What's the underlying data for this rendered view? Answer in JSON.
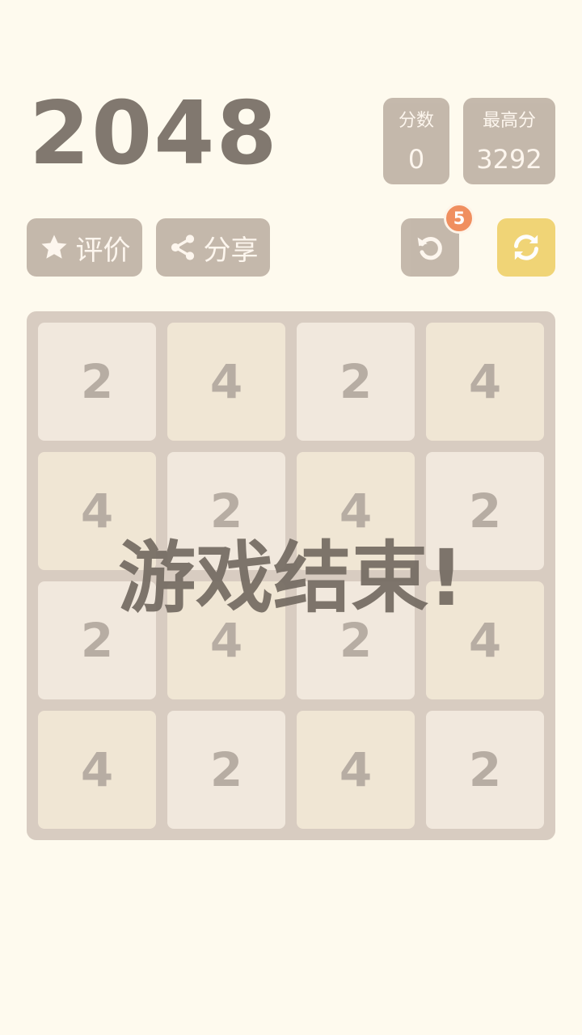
{
  "title": "2048",
  "score": {
    "label": "分数",
    "value": "0"
  },
  "best": {
    "label": "最高分",
    "value": "3292"
  },
  "buttons": {
    "rate": {
      "label": "评价",
      "icon": "star-icon"
    },
    "share": {
      "label": "分享",
      "icon": "share-icon"
    },
    "undo": {
      "icon": "undo-icon",
      "badge": "5"
    },
    "restart": {
      "icon": "refresh-icon"
    }
  },
  "board": {
    "rows": [
      [
        "2",
        "4",
        "2",
        "4"
      ],
      [
        "4",
        "2",
        "4",
        "2"
      ],
      [
        "2",
        "4",
        "2",
        "4"
      ],
      [
        "4",
        "2",
        "4",
        "2"
      ]
    ]
  },
  "overlay": {
    "message": "游戏结束!"
  },
  "colors": {
    "background": "#fefaee",
    "accent": "#f0d270",
    "badge": "#f08f5f",
    "box": "#bbada0",
    "text": "#776e65"
  }
}
